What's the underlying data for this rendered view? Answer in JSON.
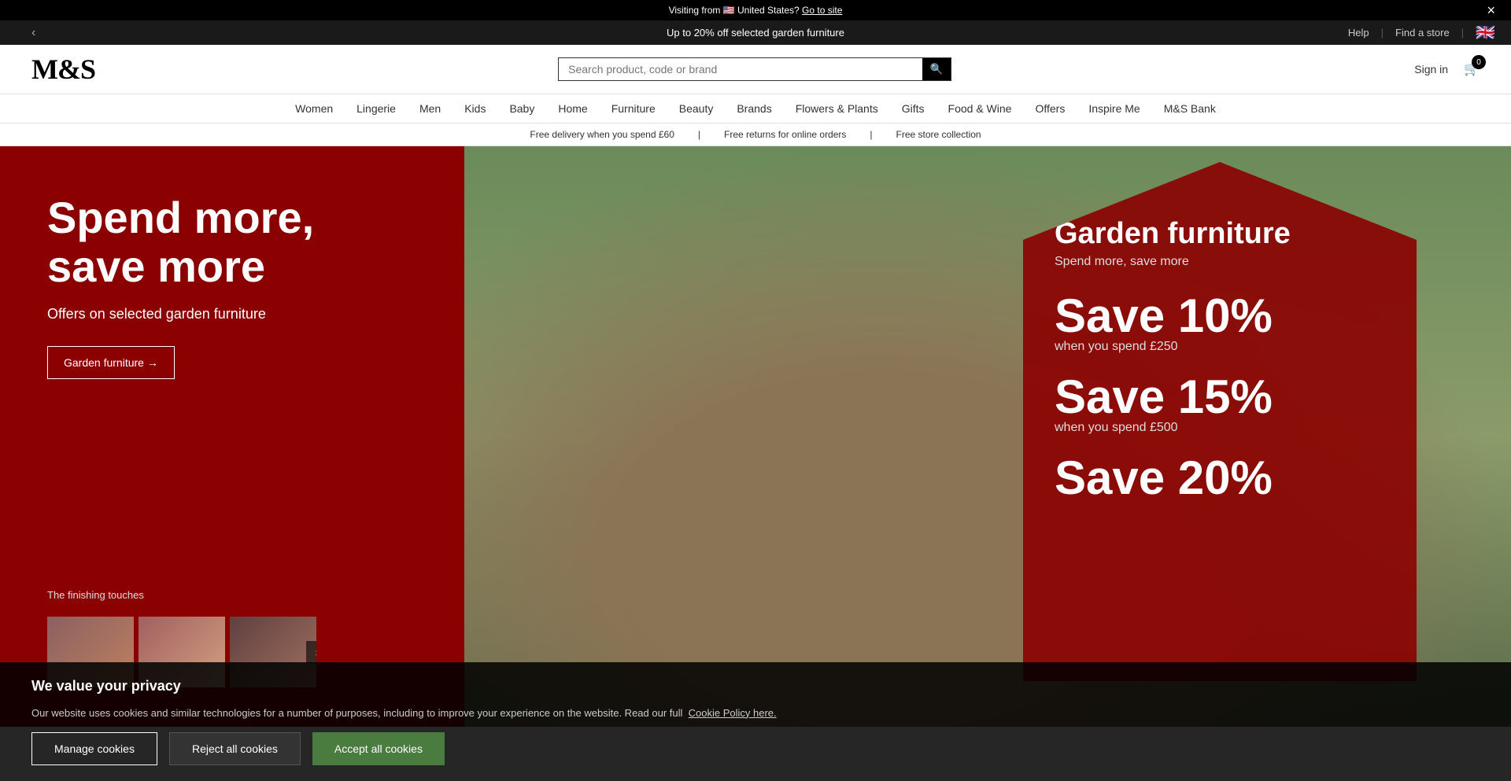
{
  "topBar": {
    "message": "Visiting from 🇺🇸 United States?",
    "linkText": "Go to site",
    "closeLabel": "×"
  },
  "promoBar": {
    "text": "Up to 20% off selected garden furniture",
    "leftArrow": "‹",
    "rightArrow": "›",
    "helpText": "Help",
    "findStoreText": "Find a store"
  },
  "header": {
    "logoText": "M&S",
    "searchPlaceholder": "Search product, code or brand",
    "searchIconLabel": "🔍",
    "signInText": "Sign in",
    "cartCount": "0",
    "flagEmoji": "🇬🇧"
  },
  "nav": {
    "items": [
      {
        "label": "Women",
        "href": "#"
      },
      {
        "label": "Lingerie",
        "href": "#"
      },
      {
        "label": "Men",
        "href": "#"
      },
      {
        "label": "Kids",
        "href": "#"
      },
      {
        "label": "Baby",
        "href": "#"
      },
      {
        "label": "Home",
        "href": "#"
      },
      {
        "label": "Furniture",
        "href": "#"
      },
      {
        "label": "Beauty",
        "href": "#"
      },
      {
        "label": "Brands",
        "href": "#"
      },
      {
        "label": "Flowers & Plants",
        "href": "#"
      },
      {
        "label": "Gifts",
        "href": "#"
      },
      {
        "label": "Food & Wine",
        "href": "#"
      },
      {
        "label": "Offers",
        "href": "#"
      },
      {
        "label": "Inspire Me",
        "href": "#"
      },
      {
        "label": "M&S Bank",
        "href": "#"
      }
    ]
  },
  "infoBar": {
    "items": [
      "Free delivery when you spend £60",
      "Free returns for online orders",
      "Free store collection"
    ]
  },
  "hero": {
    "left": {
      "title1": "Spend more,",
      "title2": "save more",
      "subtitle": "Offers on selected garden furniture",
      "ctaLabel": "Garden furniture →",
      "finishingTouches": "The finishing touches"
    },
    "overlay": {
      "title": "Garden furniture",
      "subtitle": "Spend more, save more",
      "save1Label": "Save 10%",
      "save1When": "when you spend £250",
      "save2Label": "Save 15%",
      "save2When": "when you spend £500",
      "save3Partial": "Save 20%"
    }
  },
  "cookieBanner": {
    "title": "We value your privacy",
    "body": "Our website uses cookies and similar technologies for a number of purposes, including to improve your experience on the website. Read our full",
    "linkText": "Cookie Policy here.",
    "manageBtnLabel": "Manage cookies",
    "rejectBtnLabel": "Reject all cookies",
    "acceptBtnLabel": "Accept all cookies"
  }
}
